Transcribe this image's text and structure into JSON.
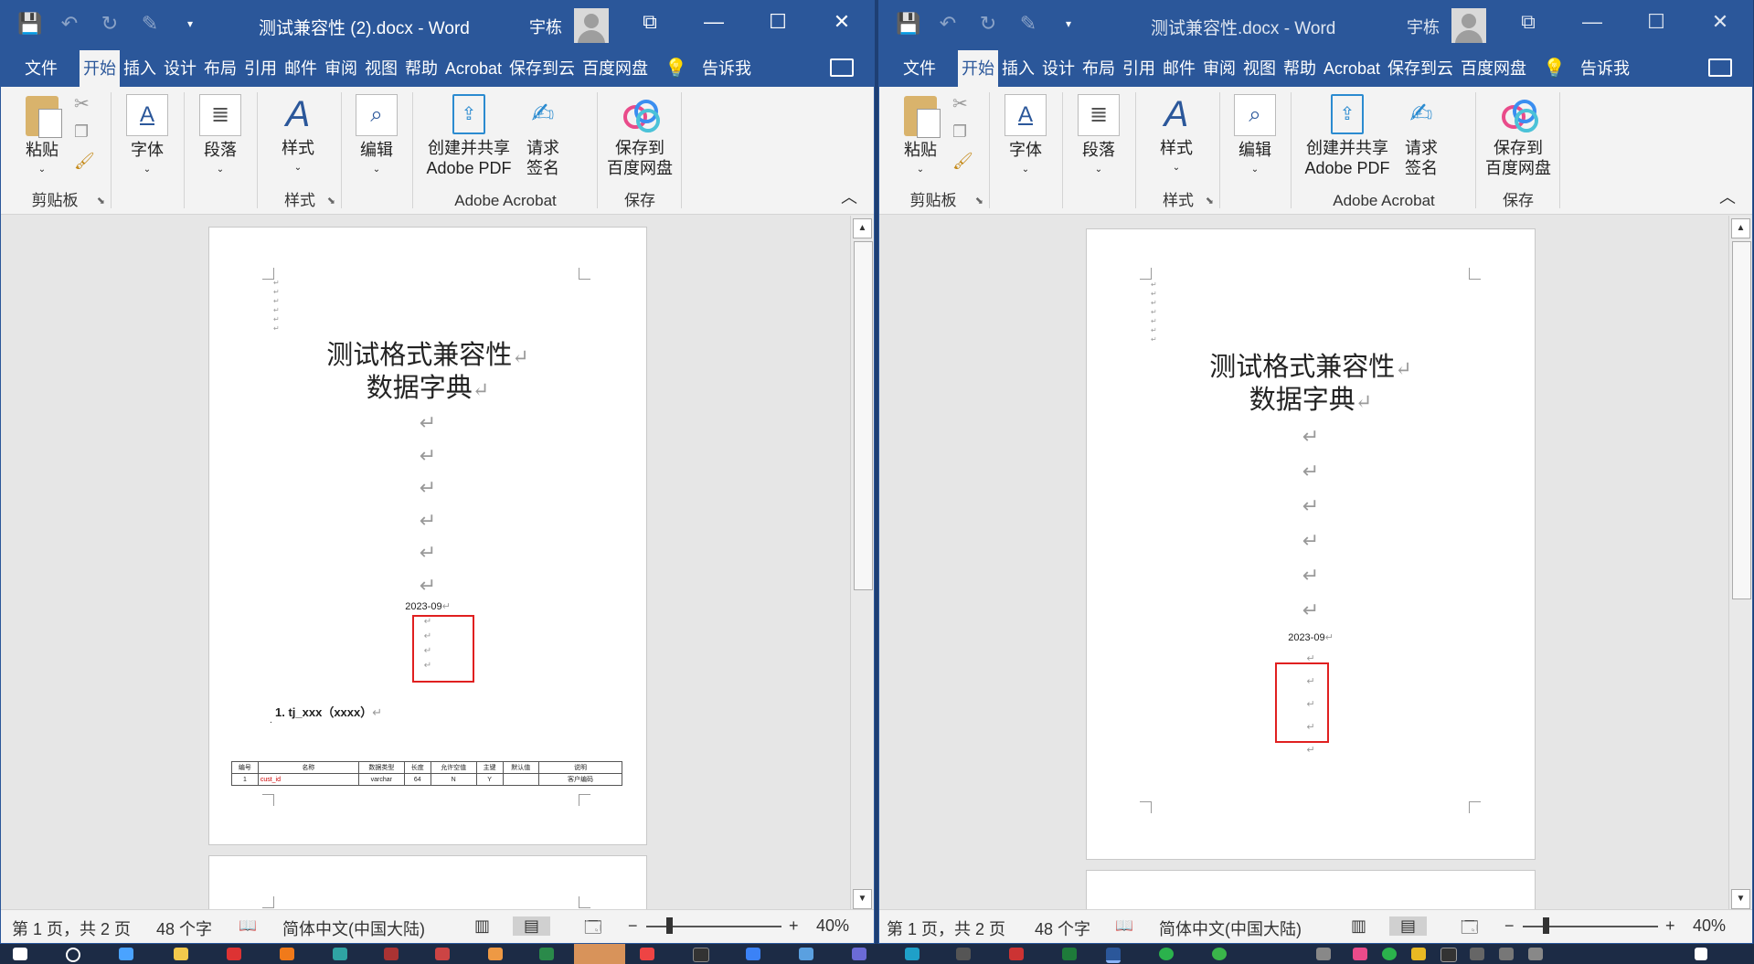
{
  "windows": [
    {
      "doc_title": "测试兼容性 (2).docx  -  Word",
      "user": "宇栋",
      "tabs": [
        "文件",
        "开始",
        "插入",
        "设计",
        "布局",
        "引用",
        "邮件",
        "审阅",
        "视图",
        "帮助",
        "Acrobat",
        "保存到云",
        "百度网盘"
      ],
      "tell_me": "告诉我",
      "ribbon": {
        "paste": "粘贴",
        "clipboard": "剪贴板",
        "font": "字体",
        "paragraph": "段落",
        "styles": "样式",
        "styles_group": "样式",
        "editing": "编辑",
        "create_pdf_1": "创建并共享",
        "create_pdf_2": "Adobe PDF",
        "sign_1": "请求",
        "sign_2": "签名",
        "acrobat_group": "Adobe Acrobat",
        "save_baidu_1": "保存到",
        "save_baidu_2": "百度网盘",
        "save_group": "保存"
      },
      "page": {
        "title1": "测试格式兼容性",
        "title2": "数据字典",
        "date": "2023-09",
        "heading": "1. tj_xxx（xxxx）",
        "table_headers": [
          "编号",
          "名称",
          "数据类型",
          "长度",
          "允许空值",
          "主键",
          "默认值",
          "说明"
        ],
        "table_row": [
          "1",
          "cust_id",
          "varchar",
          "64",
          "N",
          "Y",
          "",
          "客户编码"
        ]
      },
      "status": {
        "page": "第 1 页，共 2 页",
        "words": "48 个字",
        "language": "简体中文(中国大陆)",
        "zoom": "40%"
      }
    },
    {
      "doc_title": "测试兼容性.docx  -  Word",
      "user": "宇栋",
      "tabs": [
        "文件",
        "开始",
        "插入",
        "设计",
        "布局",
        "引用",
        "邮件",
        "审阅",
        "视图",
        "帮助",
        "Acrobat",
        "保存到云",
        "百度网盘"
      ],
      "tell_me": "告诉我",
      "ribbon": {
        "paste": "粘贴",
        "clipboard": "剪贴板",
        "font": "字体",
        "paragraph": "段落",
        "styles": "样式",
        "styles_group": "样式",
        "editing": "编辑",
        "create_pdf_1": "创建并共享",
        "create_pdf_2": "Adobe PDF",
        "sign_1": "请求",
        "sign_2": "签名",
        "acrobat_group": "Adobe Acrobat",
        "save_baidu_1": "保存到",
        "save_baidu_2": "百度网盘",
        "save_group": "保存"
      },
      "page": {
        "title1": "测试格式兼容性",
        "title2": "数据字典",
        "date": "2023-09"
      },
      "status": {
        "page": "第 1 页，共 2 页",
        "words": "48 个字",
        "language": "简体中文(中国大陆)",
        "zoom": "40%"
      }
    }
  ],
  "symbols": {
    "return": "↵",
    "save": "🖫",
    "undo": "↶",
    "redo": "↻",
    "minimize": "—",
    "maximize": "☐",
    "close": "✕",
    "restore": "⧉",
    "bulb": "💡",
    "collapse": "︿"
  },
  "colors": {
    "word_blue": "#2b579a",
    "highlight_red": "#e02020"
  }
}
